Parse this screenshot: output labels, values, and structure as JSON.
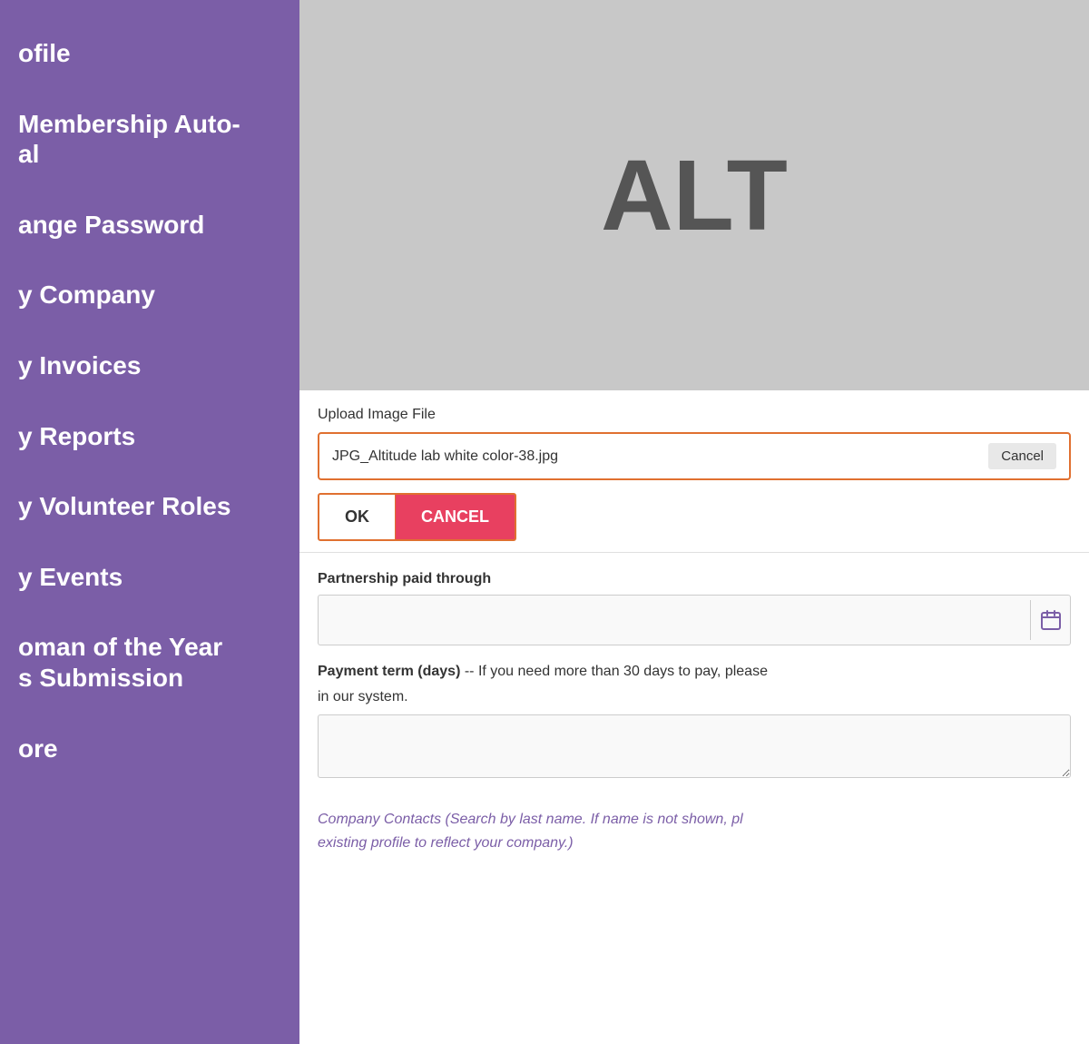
{
  "sidebar": {
    "items": [
      {
        "id": "profile",
        "label": "ofile"
      },
      {
        "id": "membership-auto",
        "label": "Membership Auto-\nal"
      },
      {
        "id": "change-password",
        "label": "ange Password"
      },
      {
        "id": "company",
        "label": "y Company"
      },
      {
        "id": "invoices",
        "label": "y Invoices"
      },
      {
        "id": "reports",
        "label": "y Reports"
      },
      {
        "id": "volunteer-roles",
        "label": "y Volunteer Roles"
      },
      {
        "id": "events",
        "label": "y Events"
      },
      {
        "id": "woman-of-year",
        "label": "oman of the Year\ns Submission"
      },
      {
        "id": "more",
        "label": "ore"
      }
    ]
  },
  "main": {
    "alt_placeholder": "ALT",
    "upload_label": "Upload Image File",
    "filename": "JPG_Altitude lab white color-38.jpg",
    "file_cancel_label": "Cancel",
    "ok_label": "OK",
    "cancel_label": "CANCEL",
    "partnership_paid_label": "Partnership paid through",
    "payment_term_label": "Payment term (days)",
    "payment_term_desc": "-- If you need more than 30 days to pay, please",
    "payment_term_desc2": "in our system.",
    "company_contacts_label": "Company Contacts (Search by last name. If name is not shown, pl",
    "company_contacts_label2": "existing profile to reflect your company.)"
  }
}
